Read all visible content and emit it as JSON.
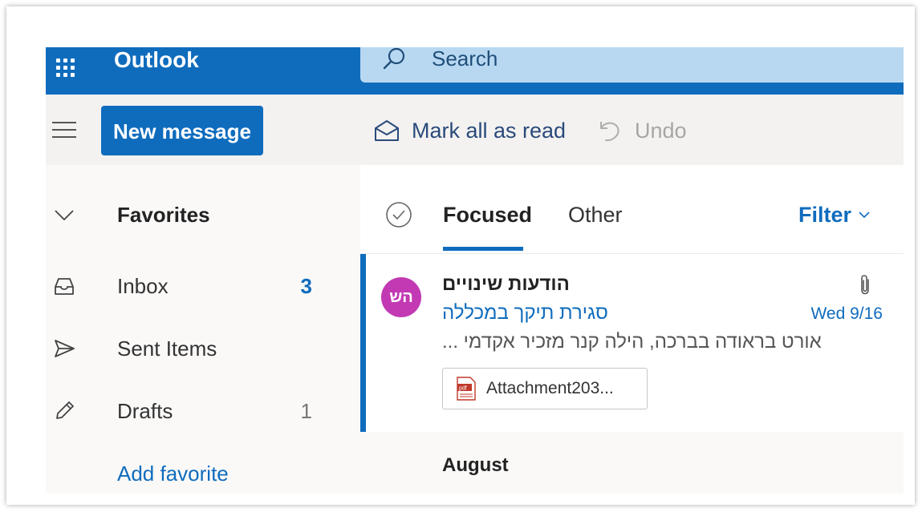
{
  "app": {
    "brand": "Outlook",
    "brand_color": "#0f6cbd"
  },
  "search": {
    "placeholder": "Search",
    "icon": "search-icon"
  },
  "toolbar": {
    "new_message_label": "New message",
    "mark_all_read_label": "Mark all as read",
    "undo_label": "Undo"
  },
  "nav": {
    "favorites_label": "Favorites",
    "items": [
      {
        "label": "Inbox",
        "count": "3",
        "icon": "inbox-icon"
      },
      {
        "label": "Sent Items",
        "count": "",
        "icon": "send-icon"
      },
      {
        "label": "Drafts",
        "count": "1",
        "icon": "pencil-icon"
      }
    ],
    "add_favorite_label": "Add favorite"
  },
  "list": {
    "tabs": [
      {
        "label": "Focused",
        "selected": true
      },
      {
        "label": "Other",
        "selected": false
      }
    ],
    "filter_label": "Filter",
    "messages": [
      {
        "avatar_initials": "הש",
        "avatar_color": "#c239b3",
        "sender": "הודעות שינויים",
        "subject": "סגירת תיקך במכללה",
        "date": "Wed 9/16",
        "preview": "אורט בראודה בברכה, הילה קנר מזכיר אקדמי ...",
        "attachment_name": "Attachment203..."
      }
    ],
    "group_header": "August"
  }
}
